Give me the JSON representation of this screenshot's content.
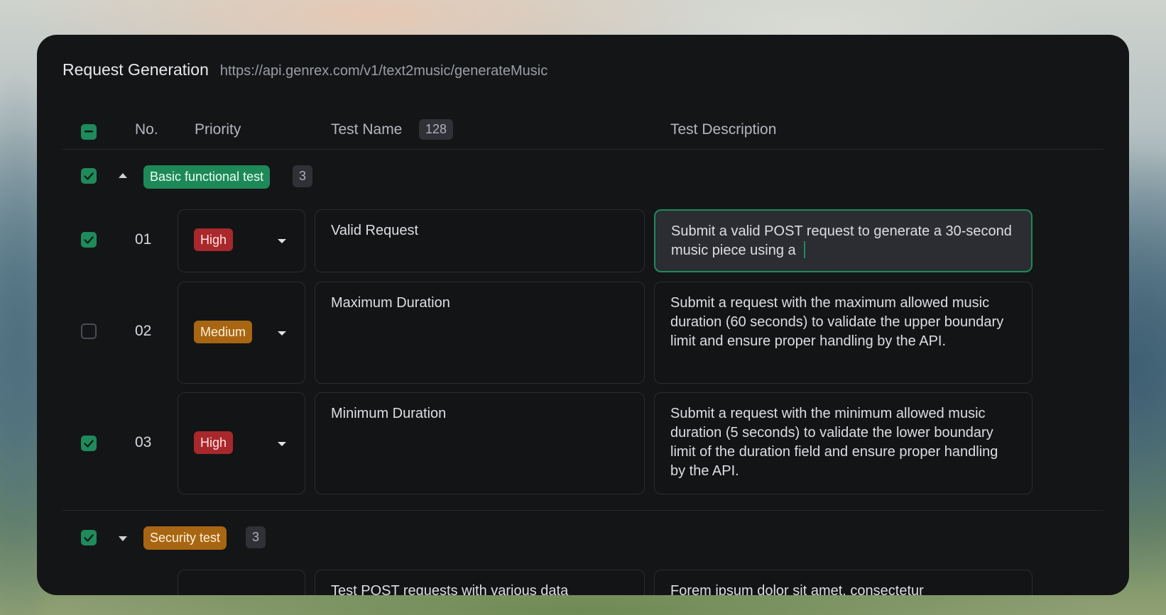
{
  "header": {
    "title": "Request Generation",
    "url": "https://api.genrex.com/v1/text2music/generateMusic"
  },
  "columns": {
    "no": "No.",
    "priority": "Priority",
    "test_name": "Test Name",
    "test_name_count": "128",
    "test_description": "Test Description"
  },
  "groups": [
    {
      "label": "Basic functional test",
      "count": "3",
      "expanded": true,
      "checked": true,
      "color": "#1e8958",
      "rows": [
        {
          "no": "01",
          "checked": true,
          "priority": "High",
          "name": "Valid Request",
          "description": "Submit a valid POST request to generate a 30-second music piece using a ",
          "editing": true
        },
        {
          "no": "02",
          "checked": false,
          "priority": "Medium",
          "name": "Maximum Duration",
          "description": "Submit a request with the maximum allowed music duration (60 seconds) to validate the upper boundary limit and ensure proper handling by the API."
        },
        {
          "no": "03",
          "checked": true,
          "priority": "High",
          "name": "Minimum Duration",
          "description": "Submit a request with the minimum allowed music duration (5 seconds) to validate the lower boundary limit of the duration field and ensure proper handling by the API."
        }
      ]
    },
    {
      "label": "Security test",
      "count": "3",
      "expanded": false,
      "checked": true,
      "color": "#a86612",
      "rows": [
        {
          "name": "Test POST requests with various data",
          "description": "Forem ipsum dolor sit amet, consectetur"
        }
      ]
    }
  ],
  "colors": {
    "accent": "#1f8a5b",
    "high": "#a8282c",
    "medium": "#a86612",
    "panel": "#141517"
  }
}
